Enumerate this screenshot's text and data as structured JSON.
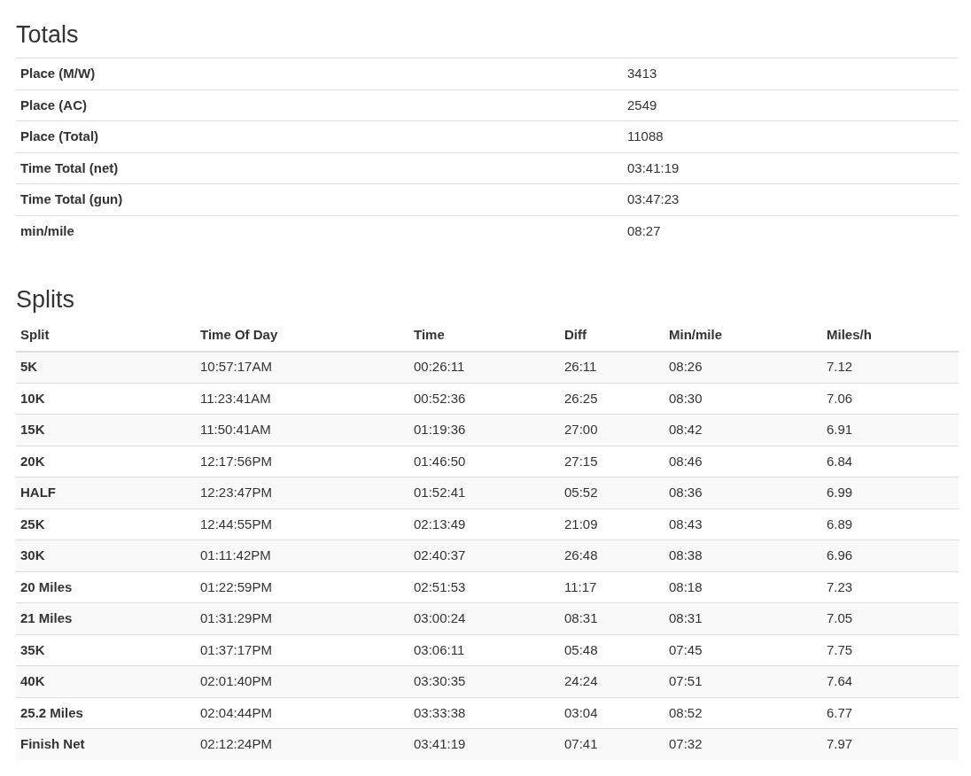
{
  "totals": {
    "title": "Totals",
    "rows": [
      {
        "label": "Place (M/W)",
        "value": "3413"
      },
      {
        "label": "Place (AC)",
        "value": "2549"
      },
      {
        "label": "Place (Total)",
        "value": "11088"
      },
      {
        "label": "Time Total (net)",
        "value": "03:41:19"
      },
      {
        "label": "Time Total (gun)",
        "value": "03:47:23"
      },
      {
        "label": "min/mile",
        "value": "08:27"
      }
    ]
  },
  "splits": {
    "title": "Splits",
    "columns": [
      "Split",
      "Time Of Day",
      "Time",
      "Diff",
      "Min/mile",
      "Miles/h"
    ],
    "rows": [
      [
        "5K",
        "10:57:17AM",
        "00:26:11",
        "26:11",
        "08:26",
        "7.12"
      ],
      [
        "10K",
        "11:23:41AM",
        "00:52:36",
        "26:25",
        "08:30",
        "7.06"
      ],
      [
        "15K",
        "11:50:41AM",
        "01:19:36",
        "27:00",
        "08:42",
        "6.91"
      ],
      [
        "20K",
        "12:17:56PM",
        "01:46:50",
        "27:15",
        "08:46",
        "6.84"
      ],
      [
        "HALF",
        "12:23:47PM",
        "01:52:41",
        "05:52",
        "08:36",
        "6.99"
      ],
      [
        "25K",
        "12:44:55PM",
        "02:13:49",
        "21:09",
        "08:43",
        "6.89"
      ],
      [
        "30K",
        "01:11:42PM",
        "02:40:37",
        "26:48",
        "08:38",
        "6.96"
      ],
      [
        "20 Miles",
        "01:22:59PM",
        "02:51:53",
        "11:17",
        "08:18",
        "7.23"
      ],
      [
        "21 Miles",
        "01:31:29PM",
        "03:00:24",
        "08:31",
        "08:31",
        "7.05"
      ],
      [
        "35K",
        "01:37:17PM",
        "03:06:11",
        "05:48",
        "07:45",
        "7.75"
      ],
      [
        "40K",
        "02:01:40PM",
        "03:30:35",
        "24:24",
        "07:51",
        "7.64"
      ],
      [
        "25.2 Miles",
        "02:04:44PM",
        "03:33:38",
        "03:04",
        "08:52",
        "6.77"
      ],
      [
        "Finish Net",
        "02:12:24PM",
        "03:41:19",
        "07:41",
        "07:32",
        "7.97"
      ]
    ]
  }
}
